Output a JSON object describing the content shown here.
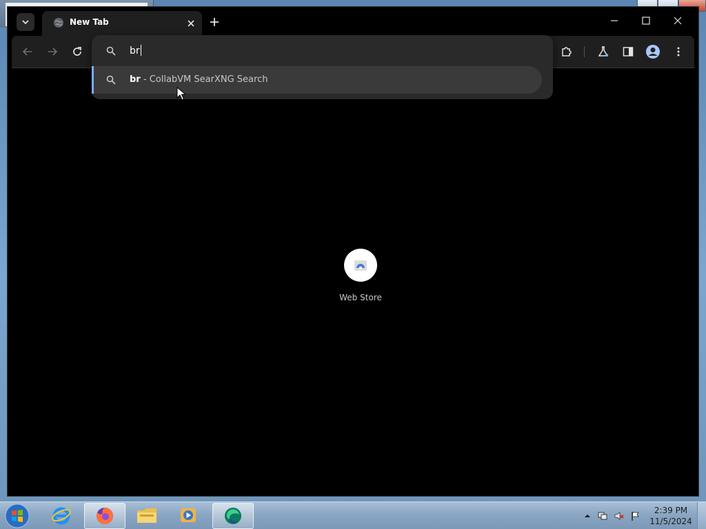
{
  "browser": {
    "tab": {
      "title": "New Tab"
    },
    "omnibox": {
      "query": "br",
      "suggestion": {
        "query": "br",
        "separator": " - ",
        "engine": "CollabVM SearXNG Search"
      }
    },
    "shortcuts": [
      {
        "label": "Web Store"
      }
    ]
  },
  "taskbar": {
    "apps": [
      "internet-explorer",
      "firefox",
      "file-explorer",
      "media-player",
      "edge"
    ],
    "clock": {
      "time": "2:39 PM",
      "date": "11/5/2024"
    }
  },
  "colors": {
    "accent": "#7cacf8",
    "toolbar": "#1f1f1f",
    "popup": "#2a2a2a",
    "suggestion_highlight": "#3a3a3a"
  }
}
